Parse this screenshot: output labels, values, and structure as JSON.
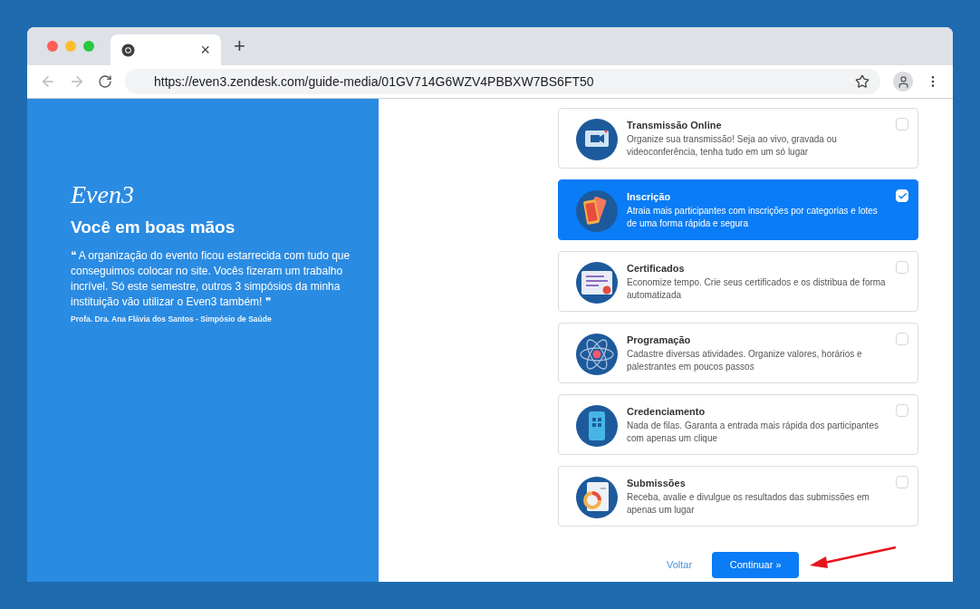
{
  "browser": {
    "tab_close": "×",
    "new_tab": "+",
    "url": "https://even3.zendesk.com/guide-media/01GV714G6WZV4PBBXW7BS6FT50"
  },
  "promo": {
    "logo": "Even3",
    "heading": "Você em boas mãos",
    "quote": "❝ A organização do evento ficou estarrecida com tudo que conseguimos colocar no site. Vocês fizeram um trabalho incrível. Só este semestre, outros 3 simpósios da minha instituição vão utilizar o Even3 também! ❞",
    "author": "Profa. Dra. Ana Flávia dos Santos - Simpósio de Saúde"
  },
  "features": [
    {
      "kind": "video",
      "title": "Transmissão Online",
      "description": "Organize sua transmissão! Seja ao vivo, gravada ou videoconferência, tenha tudo em um só lugar",
      "selected": false
    },
    {
      "kind": "tickets",
      "title": "Inscrição",
      "description": "Atraia mais participantes com inscrições por categorias e lotes de uma forma rápida e segura",
      "selected": true
    },
    {
      "kind": "certificate",
      "title": "Certificados",
      "description": "Economize tempo. Crie seus certificados e os distribua de forma automatizada",
      "selected": false
    },
    {
      "kind": "atom",
      "title": "Programação",
      "description": "Cadastre diversas atividades. Organize valores, horários e palestrantes em poucos passos",
      "selected": false
    },
    {
      "kind": "phone",
      "title": "Credenciamento",
      "description": "Nada de filas. Garanta a entrada mais rápida dos participantes com apenas um clique",
      "selected": false
    },
    {
      "kind": "chart",
      "title": "Submissões",
      "description": "Receba, avalie e divulgue os resultados das submissões em apenas um lugar",
      "selected": false
    }
  ],
  "actions": {
    "back": "Voltar",
    "next": "Continuar »"
  }
}
